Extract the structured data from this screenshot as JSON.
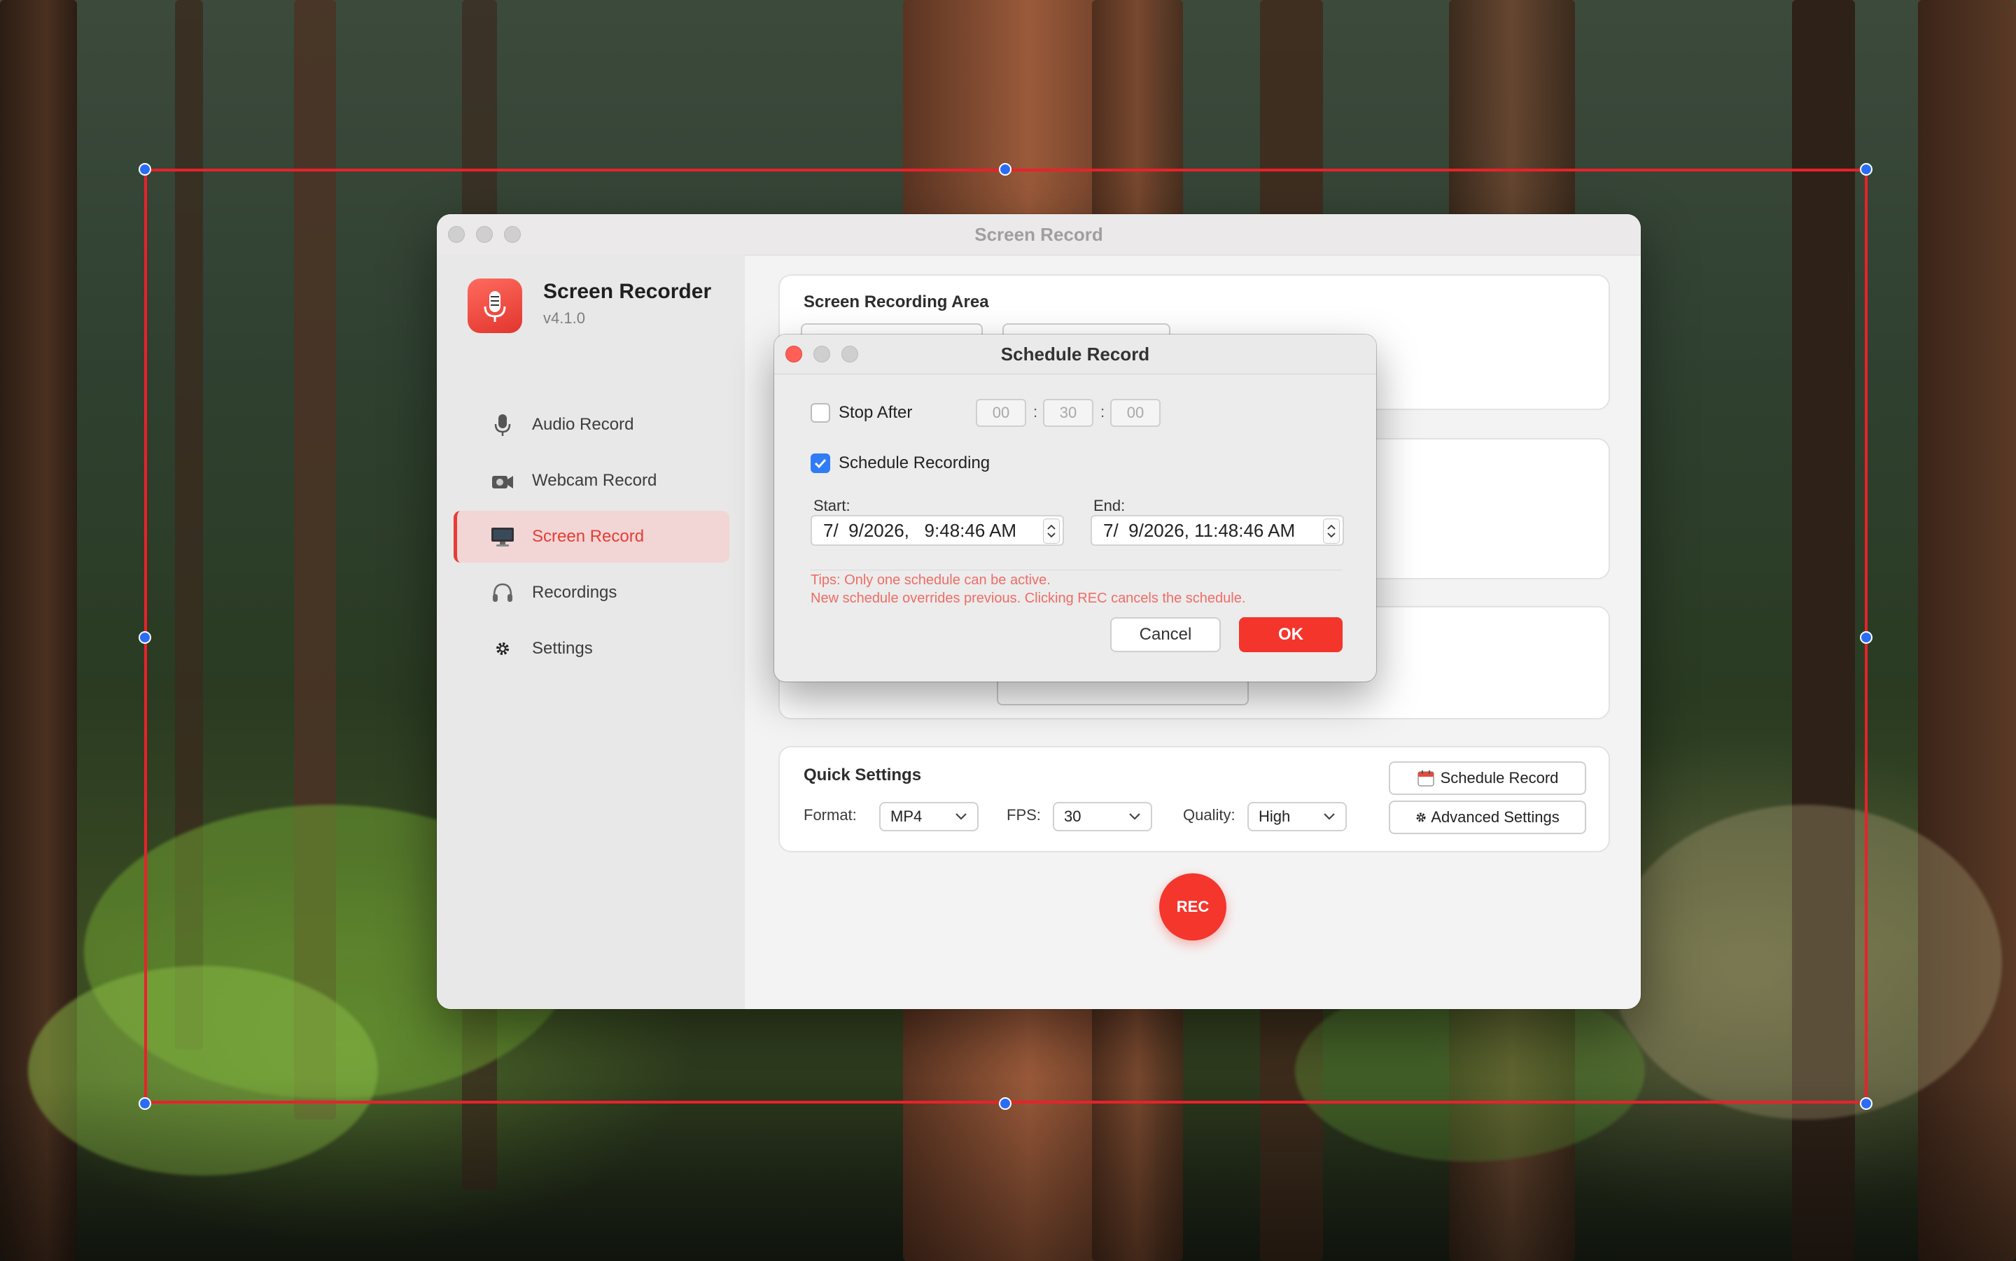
{
  "window": {
    "title": "Screen Record"
  },
  "app": {
    "name": "Screen Recorder",
    "version": "v4.1.0",
    "icon": "microphone-icon"
  },
  "sidebar": {
    "items": [
      {
        "label": "Audio Record",
        "icon": "microphone-icon",
        "active": false
      },
      {
        "label": "Webcam Record",
        "icon": "camera-icon",
        "active": false
      },
      {
        "label": "Screen Record",
        "icon": "monitor-icon",
        "active": true
      },
      {
        "label": "Recordings",
        "icon": "headphones-icon",
        "active": false
      },
      {
        "label": "Settings",
        "icon": "gear-icon",
        "active": false
      }
    ]
  },
  "main": {
    "recording_area_title": "Screen Recording Area",
    "quick_settings": {
      "title": "Quick Settings",
      "format_label": "Format:",
      "format_value": "MP4",
      "fps_label": "FPS:",
      "fps_value": "30",
      "quality_label": "Quality:",
      "quality_value": "High",
      "schedule_button": "Schedule Record",
      "advanced_button": "Advanced Settings"
    },
    "rec_button": "REC"
  },
  "dialog": {
    "title": "Schedule Record",
    "stop_after": {
      "label": "Stop After",
      "checked": false,
      "hours": "00",
      "minutes": "30",
      "seconds": "00"
    },
    "schedule_recording": {
      "label": "Schedule Recording",
      "checked": true
    },
    "start_label": "Start:",
    "start_value": "7/  9/2026,   9:48:46 AM",
    "end_label": "End:",
    "end_value": "7/  9/2026, 11:48:46 AM",
    "tips_line1": "Tips: Only one schedule can be active.",
    "tips_line2": "New schedule overrides previous. Clicking REC cancels the schedule.",
    "cancel_label": "Cancel",
    "ok_label": "OK"
  },
  "colors": {
    "accent": "#F3352C",
    "selection_border": "#E8222B",
    "selection_handle": "#2A6DF4",
    "checkbox_on": "#2F7CF6",
    "tips": "#EE6D66"
  }
}
